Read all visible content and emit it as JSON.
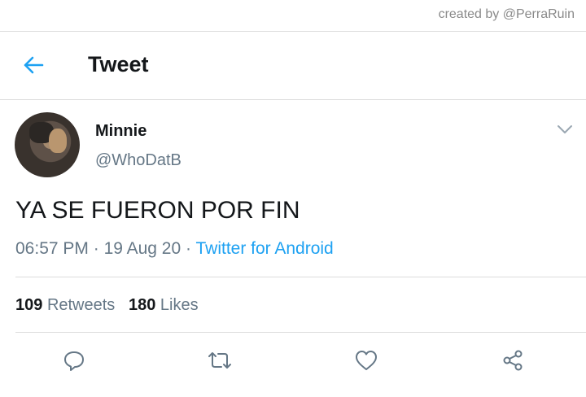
{
  "credit": "created by @PerraRuin",
  "header": {
    "title": "Tweet",
    "back_icon": "arrow-left-icon"
  },
  "tweet": {
    "author_name": "Minnie",
    "author_handle": "@WhoDatB",
    "text": "YA SE FUERON POR FIN",
    "time": "06:57 PM",
    "date": "19 Aug 20",
    "source": "Twitter for Android",
    "separator": "·"
  },
  "stats": {
    "retweets_count": "109",
    "retweets_label": "Retweets",
    "likes_count": "180",
    "likes_label": "Likes"
  },
  "actions": [
    "reply-icon",
    "retweet-icon",
    "like-icon",
    "share-icon"
  ],
  "colors": {
    "accent": "#1da1f2",
    "secondary_text": "#657786",
    "icon": "#657786",
    "divider": "#dcdcdc"
  }
}
